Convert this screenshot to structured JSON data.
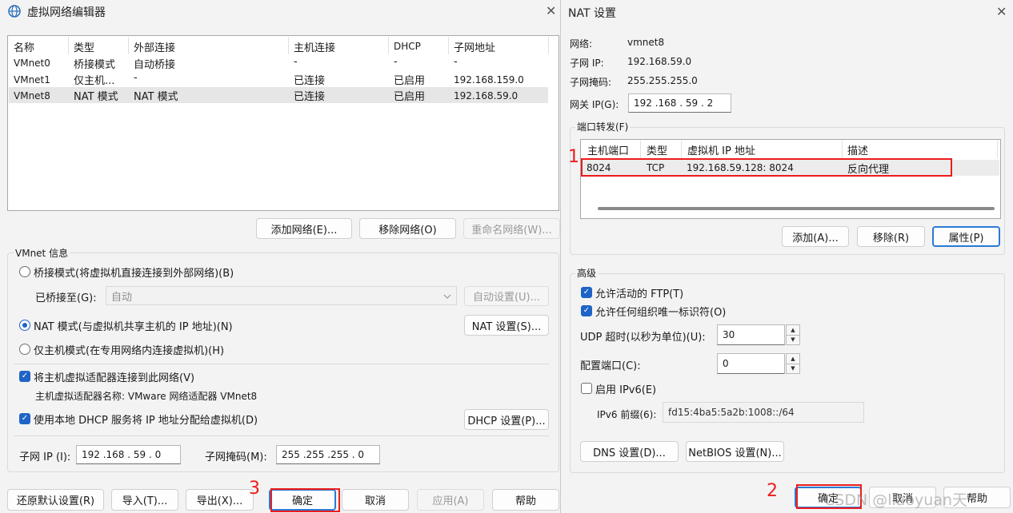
{
  "main_window": {
    "title": "虚拟网络编辑器",
    "close_glyph": "✕",
    "table": {
      "headers": [
        "名称",
        "类型",
        "外部连接",
        "主机连接",
        "DHCP",
        "子网地址"
      ],
      "rows": [
        [
          "VMnet0",
          "桥接模式",
          "自动桥接",
          "-",
          "-",
          "-"
        ],
        [
          "VMnet1",
          "仅主机...",
          "-",
          "已连接",
          "已启用",
          "192.168.159.0"
        ],
        [
          "VMnet8",
          "NAT 模式",
          "NAT 模式",
          "已连接",
          "已启用",
          "192.168.59.0"
        ]
      ]
    },
    "add_network": "添加网络(E)...",
    "remove_network": "移除网络(O)",
    "rename_network": "重命名网络(W)...",
    "info_group": "VMnet 信息",
    "bridge_mode": "桥接模式(将虚拟机直接连接到外部网络)(B)",
    "bridged_to_label": "已桥接至(G):",
    "bridged_to_value": "自动",
    "auto_settings": "自动设置(U)...",
    "nat_mode": "NAT 模式(与虚拟机共享主机的 IP 地址)(N)",
    "nat_settings": "NAT 设置(S)...",
    "host_only": "仅主机模式(在专用网络内连接虚拟机)(H)",
    "connect_adapter": "将主机虚拟适配器连接到此网络(V)",
    "adapter_name": "主机虚拟适配器名称: VMware 网络适配器 VMnet8",
    "use_dhcp": "使用本地 DHCP 服务将 IP 地址分配给虚拟机(D)",
    "dhcp_settings": "DHCP 设置(P)...",
    "subnet_ip_label": "子网 IP (I):",
    "subnet_ip": "192 .168 . 59 . 0",
    "subnet_mask_label": "子网掩码(M):",
    "subnet_mask": "255 .255 .255 . 0",
    "restore_defaults": "还原默认设置(R)",
    "import": "导入(T)...",
    "export": "导出(X)...",
    "ok": "确定",
    "cancel": "取消",
    "apply": "应用(A)",
    "help": "帮助"
  },
  "nat_dialog": {
    "title": "NAT 设置",
    "close_glyph": "✕",
    "network_label": "网络:",
    "network_value": "vmnet8",
    "subnet_ip_label": "子网 IP:",
    "subnet_ip_value": "192.168.59.0",
    "subnet_mask_label": "子网掩码:",
    "subnet_mask_value": "255.255.255.0",
    "gateway_label": "网关 IP(G):",
    "gateway_value": "192 .168 . 59 . 2",
    "port_forward_group": "端口转发(F)",
    "pf_headers": [
      "主机端口",
      "类型",
      "虚拟机 IP 地址",
      "描述"
    ],
    "pf_row": [
      "8024",
      "TCP",
      "192.168.59.128: 8024",
      "反向代理"
    ],
    "add": "添加(A)...",
    "remove": "移除(R)",
    "properties": "属性(P)",
    "advanced_group": "高级",
    "allow_ftp": "允许活动的 FTP(T)",
    "allow_uid": "允许任何组织唯一标识符(O)",
    "udp_timeout_label": "UDP 超时(以秒为单位)(U):",
    "udp_timeout_value": "30",
    "config_port_label": "配置端口(C):",
    "config_port_value": "0",
    "enable_ipv6": "启用 IPv6(E)",
    "ipv6_prefix_label": "IPv6 前缀(6):",
    "ipv6_prefix_value": "fd15:4ba5:5a2b:1008::/64",
    "dns_settings": "DNS 设置(D)...",
    "netbios_settings": "NetBIOS 设置(N)...",
    "ok": "确定",
    "cancel": "取消",
    "help": "帮助"
  },
  "annotations": {
    "n1": "1",
    "n2": "2",
    "n3": "3"
  },
  "watermark": "CSDN @liaoyuan天",
  "colors": {
    "annotation_red": "#ee1c1c",
    "checkbox_blue": "#1f63c6"
  }
}
